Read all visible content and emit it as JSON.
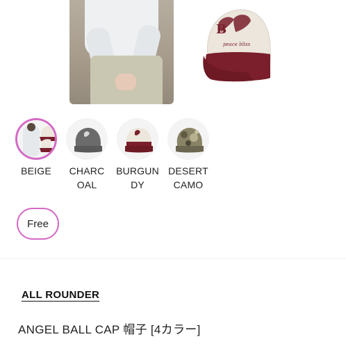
{
  "product_images": {
    "model_photo_alt": "model wearing cap",
    "cap_photo_alt": "beige cap with burgundy brim"
  },
  "colors": {
    "accent": "#d46ac6",
    "burgundy": "#7a1f2b",
    "beige": "#ece6dc",
    "charcoal": "#6b6b6b"
  },
  "color_options": [
    {
      "label": "BEIGE",
      "icon": "beige-cap-swatch",
      "selected": true
    },
    {
      "label": "CHARC\nOAL",
      "icon": "charcoal-cap-swatch",
      "selected": false
    },
    {
      "label": "BURGUN\nDY",
      "icon": "burgundy-cap-swatch",
      "selected": false
    },
    {
      "label": "DESERT\nCAMO",
      "icon": "camo-cap-swatch",
      "selected": false
    }
  ],
  "size_options": [
    {
      "label": "Free",
      "selected": true
    }
  ],
  "brand": "ALL ROUNDER",
  "product_title": "ANGEL BALL CAP 帽子 [4カラー]"
}
